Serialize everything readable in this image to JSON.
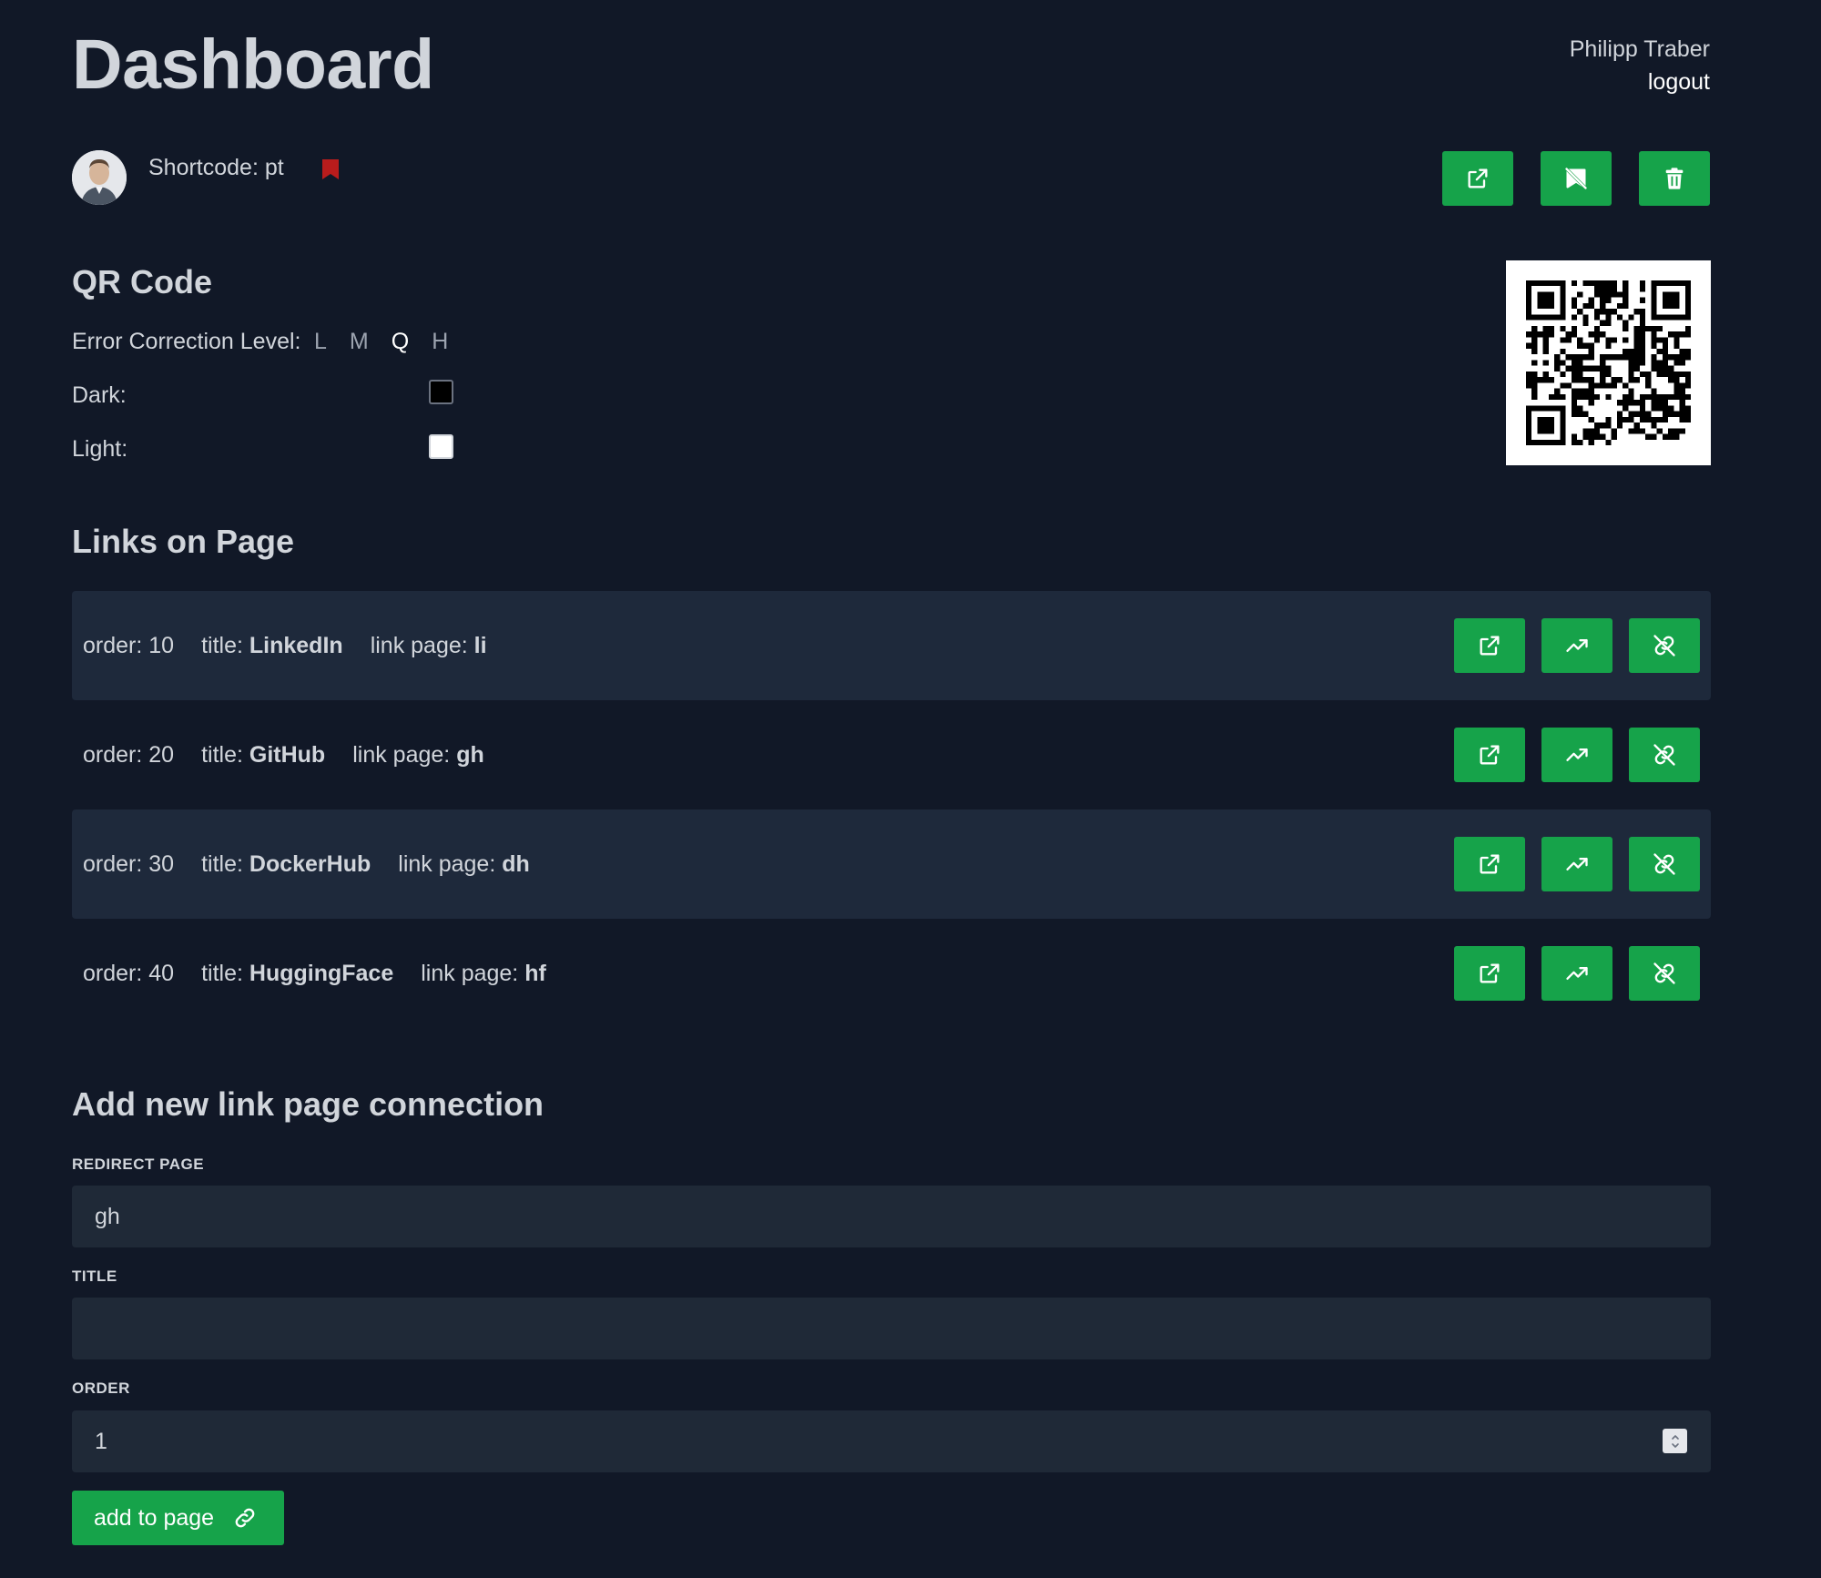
{
  "header": {
    "title": "Dashboard",
    "user_name": "Philipp Traber",
    "logout_label": "logout"
  },
  "profile": {
    "shortcode_text": "Shortcode: pt",
    "bookmark_color": "#b91c1c",
    "actions": [
      "open-external-icon",
      "unpublish-icon",
      "trash-icon"
    ]
  },
  "qr": {
    "heading": "QR Code",
    "ecl_label": "Error Correction Level:",
    "ecl_options": [
      "L",
      "M",
      "Q",
      "H"
    ],
    "ecl_selected": "Q",
    "dark_label": "Dark:",
    "dark_color": "#000000",
    "light_label": "Light:",
    "light_color": "#ffffff"
  },
  "links": {
    "heading": "Links on Page",
    "order_label": "order:",
    "title_label": "title:",
    "page_label": "link page:",
    "rows": [
      {
        "order": "10",
        "title": "LinkedIn",
        "page": "li"
      },
      {
        "order": "20",
        "title": "GitHub",
        "page": "gh"
      },
      {
        "order": "30",
        "title": "DockerHub",
        "page": "dh"
      },
      {
        "order": "40",
        "title": "HuggingFace",
        "page": "hf"
      }
    ]
  },
  "add_form": {
    "heading": "Add new link page connection",
    "redirect_label": "REDIRECT PAGE",
    "redirect_value": "gh",
    "title_label": "TITLE",
    "title_value": "",
    "order_label": "ORDER",
    "order_value": "1",
    "submit_label": "add to page"
  },
  "colors": {
    "background": "#111827",
    "accent": "#16a34a",
    "row_shade": "#1e293b",
    "input_bg": "#1f2937"
  }
}
